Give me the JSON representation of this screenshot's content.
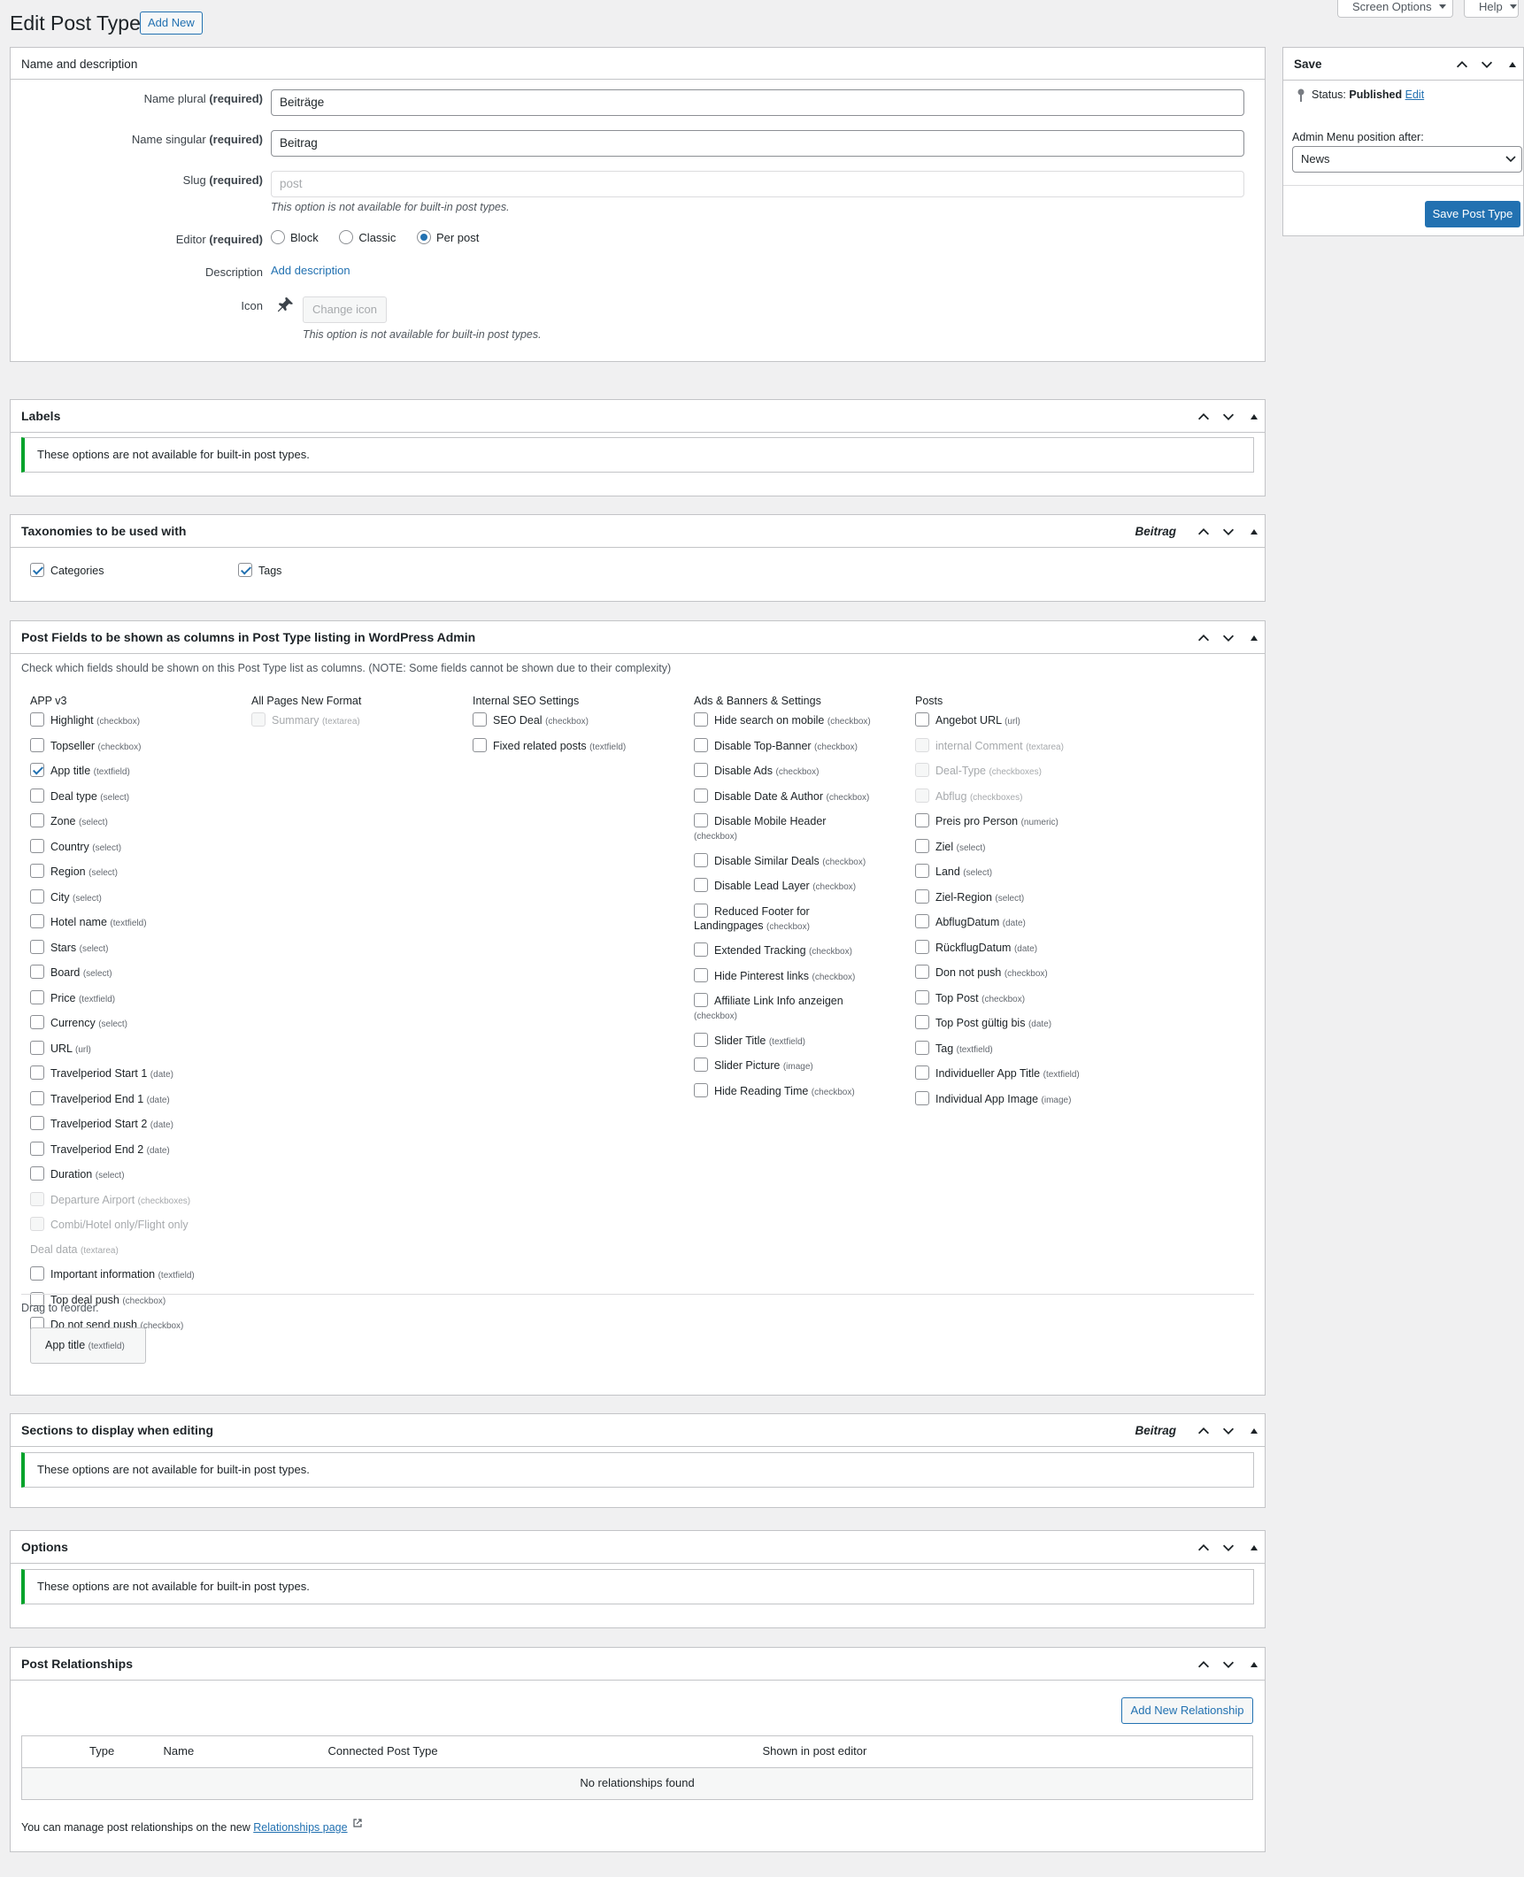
{
  "screen_meta": {
    "screen_options": "Screen Options",
    "help": "Help"
  },
  "page": {
    "title": "Edit Post Type",
    "add_new": "Add New"
  },
  "name_box": {
    "title": "Name and description",
    "name_plural_label": "Name plural",
    "name_singular_label": "Name singular",
    "slug_label": "Slug",
    "editor_label": "Editor",
    "required": "(required)",
    "name_plural_value": "Beiträge",
    "name_singular_value": "Beitrag",
    "slug_value": "post",
    "slug_hint": "This option is not available for built-in post types.",
    "editor_options": {
      "block": "Block",
      "classic": "Classic",
      "per_post": "Per post"
    },
    "editor_selected": "Per post",
    "description_label": "Description",
    "add_description": "Add description",
    "icon_label": "Icon",
    "change_icon": "Change icon",
    "icon_hint": "This option is not available for built-in post types."
  },
  "save_box": {
    "title": "Save",
    "status_label": "Status:",
    "status_value": "Published",
    "edit_link": "Edit",
    "menu_position_label": "Admin Menu position after:",
    "menu_position_value": "News",
    "save_button": "Save Post Type"
  },
  "labels_box": {
    "title": "Labels",
    "notice": "These options are not available for built-in post types."
  },
  "taxonomies_box": {
    "title": "Taxonomies to be used with",
    "badge": "Beitrag",
    "items": [
      {
        "label": "Categories",
        "checked": true
      },
      {
        "label": "Tags",
        "checked": true
      }
    ]
  },
  "fields_box": {
    "title": "Post Fields to be shown as columns in Post Type listing in WordPress Admin",
    "intro": "Check which fields should be shown on this Post Type list as columns. (NOTE: Some fields cannot be shown due to their complexity)",
    "groups": [
      {
        "name": "APP v3",
        "fields": [
          {
            "label": "Highlight",
            "type": "(checkbox)"
          },
          {
            "label": "Topseller",
            "type": "(checkbox)"
          },
          {
            "label": "App title",
            "type": "(textfield)",
            "checked": true
          },
          {
            "label": "Deal type",
            "type": "(select)"
          },
          {
            "label": "Zone",
            "type": "(select)"
          },
          {
            "label": "Country",
            "type": "(select)"
          },
          {
            "label": "Region",
            "type": "(select)"
          },
          {
            "label": "City",
            "type": "(select)"
          },
          {
            "label": "Hotel name",
            "type": "(textfield)"
          },
          {
            "label": "Stars",
            "type": "(select)"
          },
          {
            "label": "Board",
            "type": "(select)"
          },
          {
            "label": "Price",
            "type": "(textfield)"
          },
          {
            "label": "Currency",
            "type": "(select)"
          },
          {
            "label": "URL",
            "type": "(url)"
          },
          {
            "label": "Travelperiod Start 1",
            "type": "(date)"
          },
          {
            "label": "Travelperiod End 1",
            "type": "(date)"
          },
          {
            "label": "Travelperiod Start 2",
            "type": "(date)"
          },
          {
            "label": "Travelperiod End 2",
            "type": "(date)"
          },
          {
            "label": "Duration",
            "type": "(select)"
          },
          {
            "label": "Departure Airport",
            "type": "(checkboxes)",
            "disabled": true
          },
          {
            "label": "Combi/Hotel only/Flight only",
            "type": "",
            "disabled": true
          },
          {
            "label": "Deal data",
            "type": "(textarea)",
            "disabled": true,
            "nobox": true
          },
          {
            "label": "Important information",
            "type": "(textfield)",
            "wrap": true
          },
          {
            "label": "Top deal push",
            "type": "(checkbox)"
          },
          {
            "label": "Do not send push",
            "type": "(checkbox)"
          }
        ]
      },
      {
        "name": "All Pages New Format",
        "fields": [
          {
            "label": "Summary",
            "type": "(textarea)",
            "disabled": true
          }
        ]
      },
      {
        "name": "Internal SEO Settings",
        "fields": [
          {
            "label": "SEO Deal",
            "type": "(checkbox)"
          },
          {
            "label": "Fixed related posts",
            "type": "(textfield)"
          }
        ]
      },
      {
        "name": "Ads & Banners & Settings",
        "fields": [
          {
            "label": "Hide search on mobile",
            "type": "(checkbox)",
            "wrap": true
          },
          {
            "label": "Disable Top-Banner",
            "type": "(checkbox)"
          },
          {
            "label": "Disable Ads",
            "type": "(checkbox)"
          },
          {
            "label": "Disable Date & Author",
            "type": "(checkbox)",
            "wrap": true
          },
          {
            "label": "Disable Mobile Header",
            "type": "(checkbox)",
            "wrap": true
          },
          {
            "label": "Disable Similar Deals",
            "type": "(checkbox)"
          },
          {
            "label": "Disable Lead Layer",
            "type": "(checkbox)"
          },
          {
            "label": "Reduced Footer for Landingpages",
            "type": "(checkbox)",
            "wrap": true
          },
          {
            "label": "Extended Tracking",
            "type": "(checkbox)"
          },
          {
            "label": "Hide Pinterest links",
            "type": "(checkbox)"
          },
          {
            "label": "Affiliate Link Info anzeigen",
            "type": "(checkbox)",
            "wrap": true
          },
          {
            "label": "Slider Title",
            "type": "(textfield)"
          },
          {
            "label": "Slider Picture",
            "type": "(image)"
          },
          {
            "label": "Hide Reading Time",
            "type": "(checkbox)"
          }
        ]
      },
      {
        "name": "Posts",
        "fields": [
          {
            "label": "Angebot URL",
            "type": "(url)"
          },
          {
            "label": "internal Comment",
            "type": "(textarea)",
            "disabled": true
          },
          {
            "label": "Deal-Type",
            "type": "(checkboxes)",
            "disabled": true
          },
          {
            "label": "Abflug",
            "type": "(checkboxes)",
            "disabled": true
          },
          {
            "label": "Preis pro Person",
            "type": "(numeric)"
          },
          {
            "label": "Ziel",
            "type": "(select)"
          },
          {
            "label": "Land",
            "type": "(select)"
          },
          {
            "label": "Ziel-Region",
            "type": "(select)"
          },
          {
            "label": "AbflugDatum",
            "type": "(date)"
          },
          {
            "label": "RückflugDatum",
            "type": "(date)"
          },
          {
            "label": "Don not push",
            "type": "(checkbox)"
          },
          {
            "label": "Top Post",
            "type": "(checkbox)"
          },
          {
            "label": "Top Post gültig bis",
            "type": "(date)"
          },
          {
            "label": "Tag",
            "type": "(textfield)"
          },
          {
            "label": "Individueller App Title",
            "type": "(textfield)"
          },
          {
            "label": "Individual App Image",
            "type": "(image)"
          }
        ]
      }
    ],
    "drag_text": "Drag to reorder.",
    "selected_chip": {
      "label": "App title",
      "type": "(textfield)"
    }
  },
  "sections_box": {
    "title": "Sections to display when editing",
    "badge": "Beitrag",
    "notice": "These options are not available for built-in post types."
  },
  "options_box": {
    "title": "Options",
    "notice": "These options are not available for built-in post types."
  },
  "relationships_box": {
    "title": "Post Relationships",
    "add_button": "Add New Relationship",
    "columns": [
      "Type",
      "Name",
      "Connected Post Type",
      "Shown in post editor"
    ],
    "empty": "No relationships found",
    "footer_text": "You can manage post relationships on the new",
    "footer_link": "Relationships page"
  }
}
